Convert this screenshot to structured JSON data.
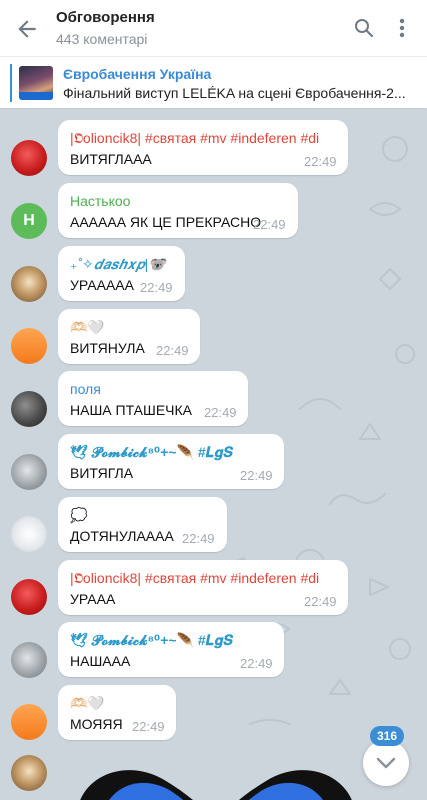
{
  "header": {
    "title": "Обговорення",
    "subtitle": "443 коментарі"
  },
  "pinned": {
    "title": "Євробачення Україна",
    "text": "Фінальний виступ LELÉKA на сцені Євробачення-2..."
  },
  "messages": [
    {
      "author": "|𝕺olioncik8| #святая #mv #indeferen #di",
      "author_color": "#e0453b",
      "text": "ВИТЯГЛААА",
      "time": "22:49"
    },
    {
      "author": "Настькоо",
      "author_color": "#4fae4e",
      "text": "АААААА ЯК ЦЕ ПРЕКРАСНО",
      "time": "22:49",
      "avatar_letter": "Н"
    },
    {
      "author": "₊˚✧𝒅𝒂𝒔𝒉𝒙𝒑|🐨",
      "author_color": "#2e9ac9",
      "text": "УРААААА",
      "time": "22:49"
    },
    {
      "author": "🫶🏻🤍",
      "author_color": "#e07a4a",
      "text": "ВИТЯНУЛА",
      "time": "22:49"
    },
    {
      "author": "поля",
      "author_color": "#3a8bd6",
      "text": "НАША ПТАШЕЧКА",
      "time": "22:49"
    },
    {
      "author": "🕊 𝓟𝓸𝓶𝓫𝓲𝓬𝓴⁸⁰+~🪶 #𝑳𝒈𝑺",
      "author_color": "#2e9ac9",
      "text": "ВИТЯГЛА",
      "time": "22:49"
    },
    {
      "author": "💭",
      "author_color": "#8a9199",
      "text": "ДОТЯНУЛАААА",
      "time": "22:49"
    },
    {
      "author": "|𝕺olioncik8| #святая #mv #indeferen #di",
      "author_color": "#e0453b",
      "text": "УРААА",
      "time": "22:49"
    },
    {
      "author": "🕊 𝓟𝓸𝓶𝓫𝓲𝓬𝓴⁸⁰+~🪶 #𝑳𝒈𝑺",
      "author_color": "#2e9ac9",
      "text": "НАШААА",
      "time": "22:49"
    },
    {
      "author": "🫶🏻🤍",
      "author_color": "#e07a4a",
      "text": "МОЯЯЯ",
      "time": "22:49"
    }
  ],
  "scroll_badge": "316",
  "colors": {
    "accent": "#3b8ed6",
    "background": "#cdd5dc"
  },
  "icons": {
    "back": "arrow-left-icon",
    "search": "search-icon",
    "menu": "more-vert-icon",
    "scroll_down": "chevron-down-icon"
  }
}
